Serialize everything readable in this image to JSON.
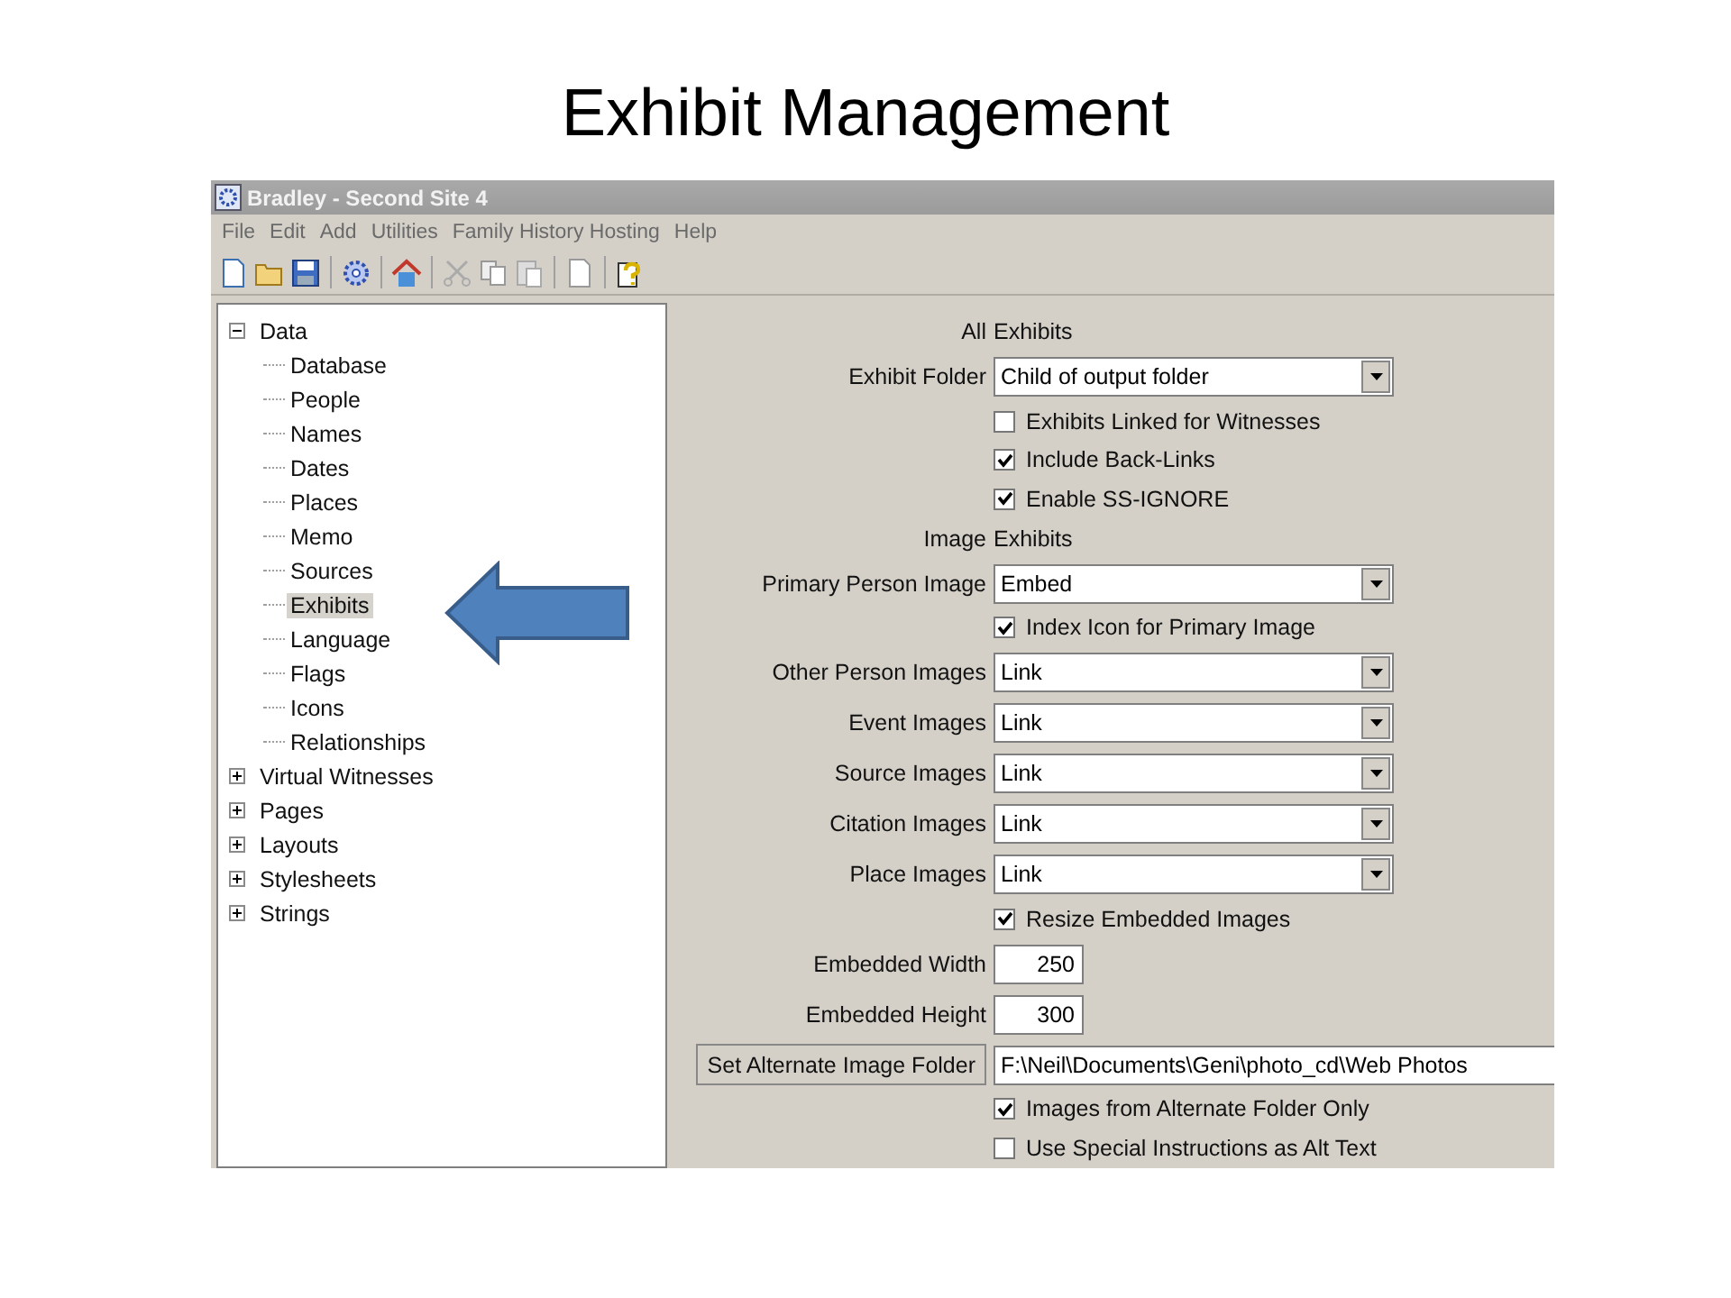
{
  "slide_title": "Exhibit Management",
  "window": {
    "title": "Bradley - Second Site 4",
    "menu": [
      "File",
      "Edit",
      "Add",
      "Utilities",
      "Family History Hosting",
      "Help"
    ]
  },
  "toolbar": [
    {
      "kind": "new"
    },
    {
      "kind": "open"
    },
    {
      "kind": "save"
    },
    {
      "kind": "separator"
    },
    {
      "kind": "gear"
    },
    {
      "kind": "separator"
    },
    {
      "kind": "home"
    },
    {
      "kind": "separator"
    },
    {
      "kind": "cut"
    },
    {
      "kind": "copy"
    },
    {
      "kind": "paste"
    },
    {
      "kind": "separator"
    },
    {
      "kind": "page"
    },
    {
      "kind": "separator"
    },
    {
      "kind": "help"
    }
  ],
  "tree": [
    {
      "label": "Data",
      "expanded": true,
      "selected": false,
      "children": [
        {
          "label": "Database",
          "selected": false
        },
        {
          "label": "People",
          "selected": false
        },
        {
          "label": "Names",
          "selected": false
        },
        {
          "label": "Dates",
          "selected": false
        },
        {
          "label": "Places",
          "selected": false
        },
        {
          "label": "Memo",
          "selected": false
        },
        {
          "label": "Sources",
          "selected": false
        },
        {
          "label": "Exhibits",
          "selected": true
        },
        {
          "label": "Language",
          "selected": false
        },
        {
          "label": "Flags",
          "selected": false
        },
        {
          "label": "Icons",
          "selected": false
        },
        {
          "label": "Relationships",
          "selected": false
        }
      ]
    },
    {
      "label": "Virtual Witnesses",
      "expanded": false,
      "selected": false
    },
    {
      "label": "Pages",
      "expanded": false,
      "selected": false
    },
    {
      "label": "Layouts",
      "expanded": false,
      "selected": false
    },
    {
      "label": "Stylesheets",
      "expanded": false,
      "selected": false
    },
    {
      "label": "Strings",
      "expanded": false,
      "selected": false
    }
  ],
  "form": {
    "rows": [
      {
        "kind": "section",
        "label": "All",
        "text": "Exhibits"
      },
      {
        "kind": "dropdown",
        "label": "Exhibit Folder",
        "value": "Child of output folder"
      },
      {
        "kind": "checkbox",
        "label": "Exhibits Linked for Witnesses",
        "checked": false
      },
      {
        "kind": "checkbox",
        "label": "Include Back-Links",
        "checked": true
      },
      {
        "kind": "checkbox",
        "label": "Enable SS-IGNORE",
        "checked": true
      },
      {
        "kind": "section",
        "label": "Image",
        "text": "Exhibits"
      },
      {
        "kind": "dropdown",
        "label": "Primary Person Image",
        "value": "Embed"
      },
      {
        "kind": "checkbox",
        "label": "Index Icon for Primary Image",
        "checked": true
      },
      {
        "kind": "dropdown",
        "label": "Other Person Images",
        "value": "Link"
      },
      {
        "kind": "dropdown",
        "label": "Event Images",
        "value": "Link"
      },
      {
        "kind": "dropdown",
        "label": "Source Images",
        "value": "Link"
      },
      {
        "kind": "dropdown",
        "label": "Citation Images",
        "value": "Link"
      },
      {
        "kind": "dropdown",
        "label": "Place Images",
        "value": "Link"
      },
      {
        "kind": "checkbox",
        "label": "Resize Embedded Images",
        "checked": true
      },
      {
        "kind": "number",
        "label": "Embedded Width",
        "value": "250"
      },
      {
        "kind": "number",
        "label": "Embedded Height",
        "value": "300"
      },
      {
        "kind": "path",
        "label": "Set Alternate Image Folder",
        "value": "F:\\Neil\\Documents\\Geni\\photo_cd\\Web Photos"
      },
      {
        "kind": "checkbox",
        "label": "Images from Alternate Folder Only",
        "checked": true
      },
      {
        "kind": "checkbox",
        "label": "Use Special Instructions as Alt Text",
        "checked": false
      }
    ]
  }
}
